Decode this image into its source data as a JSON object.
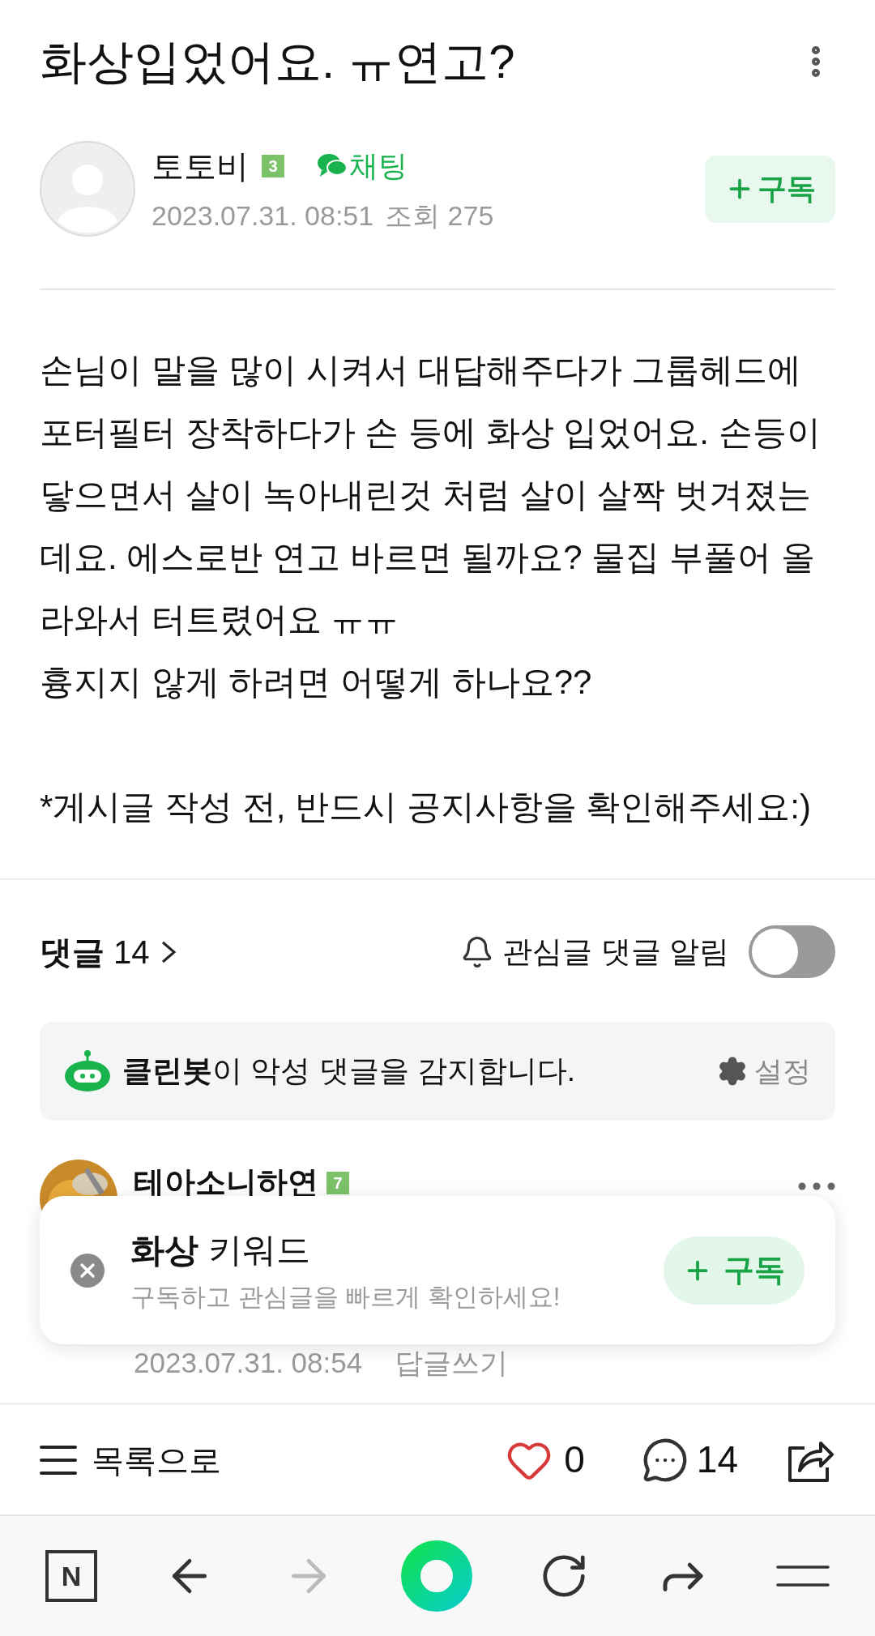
{
  "post": {
    "title": "화상입었어요. ㅠ연고?",
    "author": "토토비",
    "author_level": "3",
    "chat_label": "채팅",
    "date": "2023.07.31. 08:51",
    "views": "조회 275",
    "subscribe_label": "구독",
    "paragraphs": [
      "손님이 말을 많이 시켜서 대답해주다가 그룹헤드에 포터필터 장착하다가 손 등에 화상 입었어요. 손등이 닿으면서 살이 녹아내린것 처럼 살이 살짝 벗겨졌는데요. 에스로반 연고 바르면 될까요? 물집 부풀어 올라와서 터트렸어요 ㅠㅠ",
      "흉지지 않게 하려면 어떻게 하나요??",
      "*게시글 작성 전, 반드시 공지사항을 확인해주세요:)"
    ]
  },
  "comments": {
    "heading": "**댓글** 14",
    "alert_label": "관심글 댓글 알림",
    "alert_toggle": {
      "on": false
    },
    "cleanbot": {
      "text": "**클린봇**이 악성 댓글을 감지합니다.",
      "settings_label": "설정"
    },
    "items": [
      {
        "author": "테아소니하연",
        "level": "7",
        "date": "2023.07.31. 08:54",
        "reply_label": "답글쓰기"
      }
    ]
  },
  "keyword_popup": {
    "title": "**화상** 키워드",
    "subtitle": "구독하고 관심글을 빠르게 확인하세요!",
    "subscribe_label": "구독"
  },
  "action_bar": {
    "list_label": "목록으로",
    "likes": "0",
    "comments": "14"
  },
  "browser_bar": {
    "logo": "N",
    "forward_disabled": true
  }
}
